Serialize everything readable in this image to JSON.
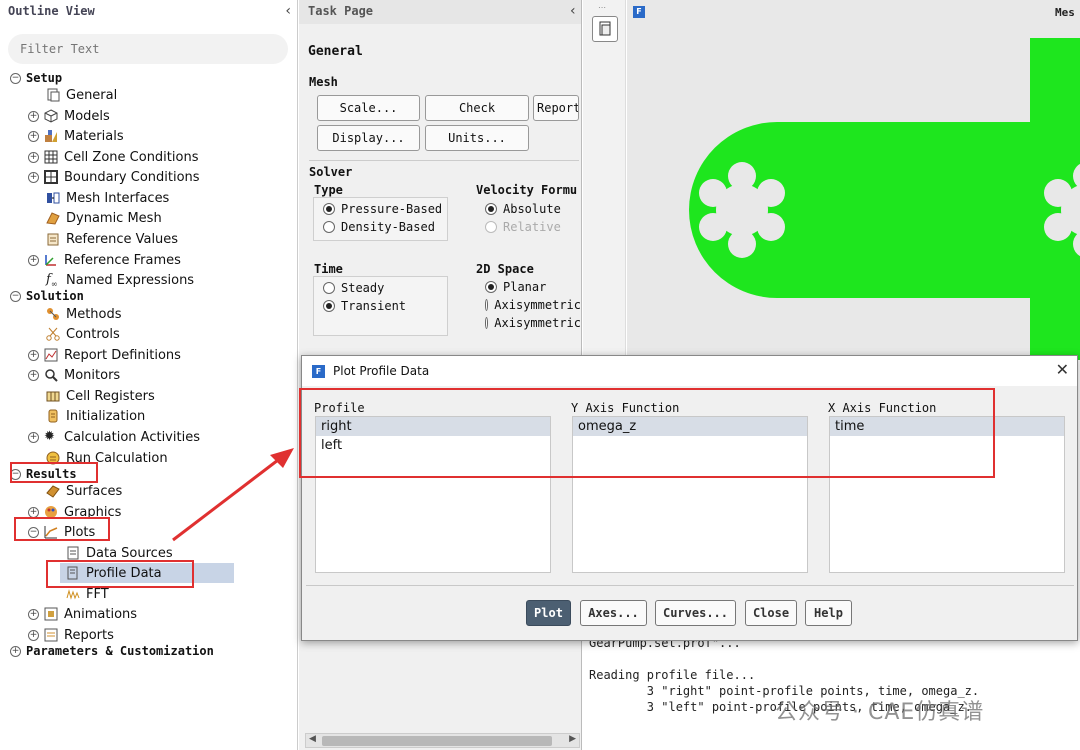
{
  "outline": {
    "title": "Outline View",
    "filter_placeholder": "Filter Text",
    "setup": {
      "label": "Setup",
      "items": [
        {
          "label": "General"
        },
        {
          "label": "Models"
        },
        {
          "label": "Materials"
        },
        {
          "label": "Cell Zone Conditions"
        },
        {
          "label": "Boundary Conditions"
        },
        {
          "label": "Mesh Interfaces"
        },
        {
          "label": "Dynamic Mesh"
        },
        {
          "label": "Reference Values"
        },
        {
          "label": "Reference Frames"
        },
        {
          "label": "Named Expressions"
        }
      ]
    },
    "solution": {
      "label": "Solution",
      "items": [
        {
          "label": "Methods"
        },
        {
          "label": "Controls"
        },
        {
          "label": "Report Definitions"
        },
        {
          "label": "Monitors"
        },
        {
          "label": "Cell Registers"
        },
        {
          "label": "Initialization"
        },
        {
          "label": "Calculation Activities"
        },
        {
          "label": "Run Calculation"
        }
      ]
    },
    "results": {
      "label": "Results",
      "items": [
        {
          "label": "Surfaces"
        },
        {
          "label": "Graphics"
        },
        {
          "label": "Plots"
        },
        {
          "label": "Data Sources"
        },
        {
          "label": "Profile Data"
        },
        {
          "label": "FFT"
        },
        {
          "label": "Animations"
        },
        {
          "label": "Reports"
        }
      ]
    },
    "parameters": {
      "label": "Parameters & Customization"
    }
  },
  "task": {
    "title": "Task Page",
    "heading": "General",
    "mesh": {
      "label": "Mesh",
      "scale": "Scale...",
      "check": "Check",
      "report": "Report",
      "display": "Display...",
      "units": "Units..."
    },
    "solver": {
      "label": "Solver",
      "type_label": "Type",
      "type_options": [
        "Pressure-Based",
        "Density-Based"
      ],
      "velocity_label": "Velocity Formu",
      "velocity_options": [
        "Absolute",
        "Relative"
      ],
      "time_label": "Time",
      "time_options": [
        "Steady",
        "Transient"
      ],
      "space_label": "2D Space",
      "space_options": [
        "Planar",
        "Axisymmetric",
        "Axisymmetric"
      ]
    }
  },
  "graphics": {
    "mesh_label": "Mes"
  },
  "console": {
    "lines": [
      "GearPump.set.prof\"...",
      "",
      "Reading profile file...",
      "        3 \"right\" point-profile points, time, omega_z.",
      "        3 \"left\" point-profile points, time, omega_z."
    ],
    "watermark": "公众号 · CAE仿真谱"
  },
  "dialog": {
    "title": "Plot Profile Data",
    "profile_label": "Profile",
    "profiles": [
      "right",
      "left"
    ],
    "y_label": "Y Axis Function",
    "y_functions": [
      "omega_z"
    ],
    "x_label": "X Axis Function",
    "x_functions": [
      "time"
    ],
    "buttons": {
      "plot": "Plot",
      "axes": "Axes...",
      "curves": "Curves...",
      "close": "Close",
      "help": "Help"
    }
  },
  "colors": {
    "accent_red": "#e03030",
    "mesh_green": "#1ee61e",
    "selection": "#c8d4e6"
  }
}
